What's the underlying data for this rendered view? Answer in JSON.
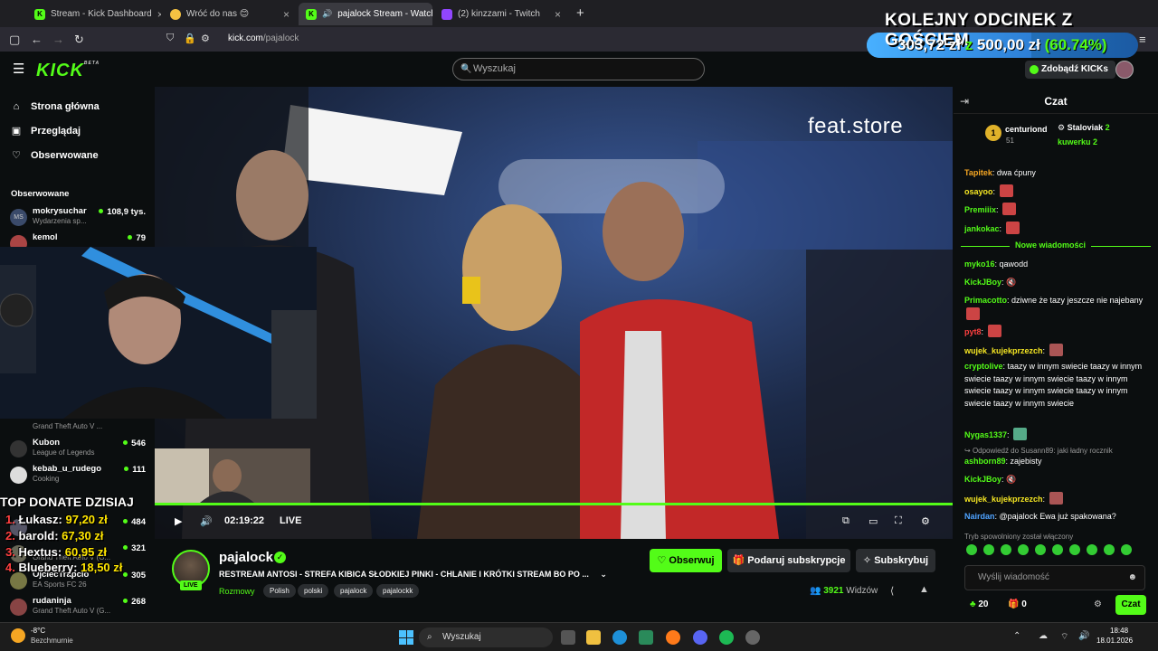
{
  "browser": {
    "tabs": [
      {
        "title": "Stream - Kick Dashboard",
        "color": "#53fc18",
        "glyph": "K"
      },
      {
        "title": "Wróć do nas 😊",
        "color": "#f5c242",
        "glyph": ""
      },
      {
        "title": "pajalock Stream - Watch L",
        "color": "#53fc18",
        "glyph": "K",
        "active": true
      },
      {
        "title": "(2) kinzzami - Twitch",
        "color": "#9146ff",
        "glyph": ""
      }
    ],
    "url_host": "kick.com",
    "url_path": "/pajalock",
    "new_tab": "+"
  },
  "overlay_goal": {
    "title": "KOLEJNY ODCINEK Z GOŚCIEM",
    "current": "303,72 zł",
    "joiner": "z",
    "goal": "500,00 zł",
    "percent_text": "(60.74%)",
    "progress": 0.6074
  },
  "header": {
    "logo": "KICK",
    "logo_sup": "BETA",
    "search_placeholder": "Wyszukaj",
    "get_kicks": "Zdobądź KICKs"
  },
  "sidebar": {
    "nav": [
      {
        "label": "Strona główna",
        "icon": "home-icon",
        "glyph": "⌂"
      },
      {
        "label": "Przeglądaj",
        "icon": "browse-icon",
        "glyph": "▣"
      },
      {
        "label": "Obserwowane",
        "icon": "heart-icon",
        "glyph": "♡"
      }
    ],
    "followed_title": "Obserwowane",
    "followed_top": [
      {
        "name": "mokrysuchar",
        "category": "Wydarzenia sp...",
        "viewers": "108,9 tys.",
        "color": "#3a4a6a"
      },
      {
        "name": "kemol",
        "category": "",
        "viewers": "79",
        "color": "#a44"
      }
    ],
    "followed_bottom_cat": "Grand Theft Auto V ...",
    "followed_bottom": [
      {
        "name": "Kubon",
        "category": "League of Legends",
        "viewers": "546",
        "color": "#333"
      },
      {
        "name": "kebab_u_rudego",
        "category": "Cooking",
        "viewers": "111",
        "color": "#ddd"
      },
      {
        "name": "",
        "category": "",
        "viewers": "484",
        "color": "#556"
      },
      {
        "name": "",
        "category": "Grand Theft Auto V (G...",
        "viewers": "321",
        "color": "#665"
      },
      {
        "name": "OjciecTrapcio",
        "category": "EA Sports FC 26",
        "viewers": "305",
        "color": "#774"
      },
      {
        "name": "rudaninja",
        "category": "Grand Theft Auto V (G...",
        "viewers": "268",
        "color": "#844"
      }
    ]
  },
  "donate": {
    "title": "TOP DONATE DZISIAJ",
    "rows": [
      {
        "rank": "1.",
        "name": "Łukasz:",
        "amount": "97,20 zł"
      },
      {
        "rank": "2.",
        "name": "barold:",
        "amount": "67,30 zł"
      },
      {
        "rank": "3.",
        "name": "Hextus:",
        "amount": "60,95 zł"
      },
      {
        "rank": "4.",
        "name": "Blueberry:",
        "amount": "18,50 zł"
      }
    ]
  },
  "video": {
    "watermark": "feat.store",
    "time": "02:19:22",
    "live_label": "LIVE",
    "progress": 1.0
  },
  "stream": {
    "name": "pajalock",
    "live_badge": "LIVE",
    "title": "RESTREAM ANTOSI - STREFA KIBICA SŁODKIEJ PINKI - CHLANIE I KRÓTKI STREAM BO PO ...",
    "category": "Rozmowy",
    "tags": [
      "Polish",
      "polski",
      "pajalock",
      "pajalockk"
    ],
    "follow_label": "Obserwuj",
    "gift_label": "Podaruj subskrypcje",
    "subscribe_label": "Subskrybuj",
    "viewers_count": "3921",
    "viewers_label": "Widzów"
  },
  "chat": {
    "title": "Czat",
    "leaders": [
      {
        "name": "centuriond",
        "count": "51"
      },
      {
        "name": "Staloviak",
        "count": "2"
      },
      {
        "name": "kuwerku",
        "count": "2"
      }
    ],
    "new_messages": "Nowe wiadomości",
    "messages_top": [
      {
        "user": "Tapitek",
        "color": "#f5a623",
        "text": "dwa ćpuny",
        "emotes": 0
      },
      {
        "user": "osayoo",
        "color": "#f5e623",
        "text": "",
        "emotes": 1
      },
      {
        "user": "Premiiix",
        "color": "#53fc18",
        "text": "",
        "emotes": 1
      },
      {
        "user": "jankokac",
        "color": "#53fc18",
        "text": "",
        "emotes": 1
      }
    ],
    "messages": [
      {
        "user": "myko16",
        "color": "#53fc18",
        "text": "qawodd"
      },
      {
        "user": "KickJBoy",
        "color": "#53fc18",
        "text": "🔇"
      },
      {
        "user": "Primacotto",
        "color": "#53fc18",
        "text": "dziwne że tazy jeszcze nie najebany"
      },
      {
        "user": "pyt8",
        "color": "#ff4040",
        "text": ""
      },
      {
        "user": "wujek_kujekprzezch",
        "color": "#f5e623",
        "text": ""
      },
      {
        "user": "cryptolive",
        "color": "#53fc18",
        "text": "taazy w innym swiecie taazy w innym swiecie taazy w innym swiecie taazy w innym swiecie taazy w innym swiecie taazy w innym swiecie taazy w innym swiecie"
      },
      {
        "user": "Nygas1337",
        "color": "#53fc18",
        "text": ""
      },
      {
        "reply": "Odpowiedź do Susann89: jaki ładny rocznik"
      },
      {
        "user": "ashborn89",
        "color": "#53fc18",
        "text": "zajebisty"
      },
      {
        "user": "KickJBoy",
        "color": "#53fc18",
        "text": "🔇"
      },
      {
        "user": "wujek_kujekprzezch",
        "color": "#f5e623",
        "text": ""
      },
      {
        "user": "Nairdan",
        "color": "#4fa3ff",
        "text": "@pajalock Ewa już spakowana?"
      }
    ],
    "slow_mode": "Tryb spowolniony został włączony",
    "input_placeholder": "Wyślij wiadomość",
    "kicks_count": "20",
    "gifts_count": "0",
    "send_label": "Czat"
  },
  "taskbar": {
    "weather_temp": "-8°C",
    "weather_desc": "Bezchmurnie",
    "search": "Wyszukaj",
    "time": "18:48",
    "date": "18.01.2026"
  }
}
